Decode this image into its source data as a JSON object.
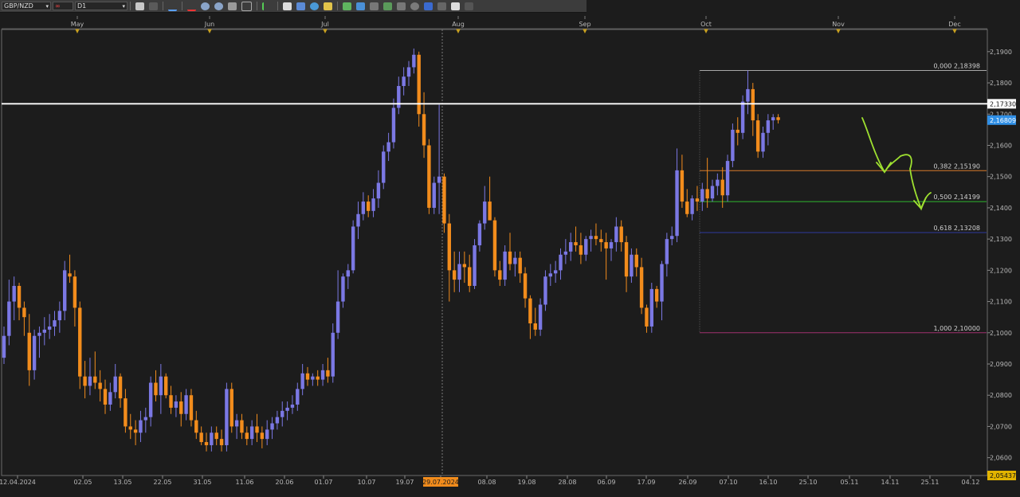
{
  "toolbar": {
    "symbol": "GBP/NZD",
    "period": "D1",
    "icons": [
      "candle-type-icon",
      "cursor-icon",
      "line-tool-icon",
      "zoom-in-icon",
      "zoom-out-icon",
      "crosshair-icon",
      "text-tool-icon",
      "circle-tool-icon",
      "pencil-icon",
      "indicator-icon",
      "settings-icon",
      "grid-icon",
      "clock-icon",
      "eraser-icon"
    ]
  },
  "chart_data": {
    "type": "candlestick",
    "symbol": "GBP/NZD",
    "timeframe": "D1",
    "ylim": [
      2.0543,
      2.1971
    ],
    "y_ticks": [
      "2,0600",
      "2,0700",
      "2,0800",
      "2,0900",
      "2,1000",
      "2,1100",
      "2,1200",
      "2,1300",
      "2,1400",
      "2,1500",
      "2,1600",
      "2,1700",
      "2,1800",
      "2,1900"
    ],
    "month_labels": [
      "May",
      "Jun",
      "Jul",
      "Aug",
      "Sep",
      "Oct",
      "Nov",
      "Dec"
    ],
    "date_labels": [
      "12.04.2024",
      "02.05",
      "13.05",
      "22.05",
      "31.05",
      "11.06",
      "20.06",
      "01.07",
      "10.07",
      "19.07",
      "29.07.2024",
      "08.08",
      "19.08",
      "28.08",
      "06.09",
      "17.09",
      "26.09",
      "07.10",
      "16.10",
      "25.10",
      "05.11",
      "14.11",
      "25.11",
      "04.12"
    ],
    "crosshair_date": "29.07.2024",
    "current_price": "2,16809",
    "horizontal_line": "2,17330",
    "axis_low_label": "2,05437",
    "fibonacci": [
      {
        "level": "0,000",
        "price": "2,18398",
        "color": "#a8a8a8"
      },
      {
        "level": "0,382",
        "price": "2,15190",
        "color": "#d77a2a"
      },
      {
        "level": "0,500",
        "price": "2,14199",
        "color": "#2fb82f"
      },
      {
        "level": "0,618",
        "price": "2,13208",
        "color": "#2e3a9e"
      },
      {
        "level": "1,000",
        "price": "2,10000",
        "color": "#a0306e"
      }
    ],
    "bull_color": "#7b78e4",
    "bear_color": "#f28c1c",
    "candles": [
      [
        2.092,
        2.102,
        2.09,
        2.099
      ],
      [
        2.099,
        2.117,
        2.096,
        2.11
      ],
      [
        2.11,
        2.118,
        2.104,
        2.115
      ],
      [
        2.115,
        2.116,
        2.104,
        2.108
      ],
      [
        2.108,
        2.11,
        2.099,
        2.105
      ],
      [
        2.1,
        2.106,
        2.083,
        2.088
      ],
      [
        2.088,
        2.101,
        2.085,
        2.099
      ],
      [
        2.099,
        2.102,
        2.092,
        2.1
      ],
      [
        2.1,
        2.105,
        2.096,
        2.101
      ],
      [
        2.101,
        2.106,
        2.098,
        2.102
      ],
      [
        2.102,
        2.107,
        2.099,
        2.104
      ],
      [
        2.104,
        2.11,
        2.1,
        2.107
      ],
      [
        2.107,
        2.123,
        2.104,
        2.12
      ],
      [
        2.119,
        2.125,
        2.116,
        2.118
      ],
      [
        2.118,
        2.12,
        2.102,
        2.108
      ],
      [
        2.108,
        2.11,
        2.082,
        2.086
      ],
      [
        2.086,
        2.091,
        2.079,
        2.083
      ],
      [
        2.083,
        2.092,
        2.08,
        2.086
      ],
      [
        2.086,
        2.094,
        2.082,
        2.084
      ],
      [
        2.084,
        2.088,
        2.078,
        2.082
      ],
      [
        2.082,
        2.085,
        2.074,
        2.077
      ],
      [
        2.077,
        2.084,
        2.075,
        2.081
      ],
      [
        2.081,
        2.09,
        2.079,
        2.086
      ],
      [
        2.086,
        2.087,
        2.076,
        2.079
      ],
      [
        2.079,
        2.082,
        2.068,
        2.07
      ],
      [
        2.07,
        2.074,
        2.066,
        2.069
      ],
      [
        2.069,
        2.072,
        2.064,
        2.068
      ],
      [
        2.068,
        2.075,
        2.065,
        2.072
      ],
      [
        2.072,
        2.076,
        2.068,
        2.073
      ],
      [
        2.073,
        2.086,
        2.07,
        2.084
      ],
      [
        2.084,
        2.088,
        2.078,
        2.08
      ],
      [
        2.08,
        2.09,
        2.074,
        2.086
      ],
      [
        2.086,
        2.087,
        2.079,
        2.08
      ],
      [
        2.08,
        2.083,
        2.074,
        2.076
      ],
      [
        2.076,
        2.08,
        2.073,
        2.078
      ],
      [
        2.078,
        2.081,
        2.07,
        2.074
      ],
      [
        2.074,
        2.082,
        2.072,
        2.08
      ],
      [
        2.08,
        2.082,
        2.07,
        2.072
      ],
      [
        2.072,
        2.075,
        2.066,
        2.068
      ],
      [
        2.068,
        2.07,
        2.064,
        2.065
      ],
      [
        2.065,
        2.068,
        2.062,
        2.064
      ],
      [
        2.064,
        2.07,
        2.062,
        2.068
      ],
      [
        2.068,
        2.07,
        2.064,
        2.066
      ],
      [
        2.066,
        2.069,
        2.062,
        2.064
      ],
      [
        2.064,
        2.084,
        2.062,
        2.082
      ],
      [
        2.082,
        2.084,
        2.068,
        2.07
      ],
      [
        2.07,
        2.074,
        2.066,
        2.072
      ],
      [
        2.072,
        2.074,
        2.066,
        2.068
      ],
      [
        2.068,
        2.07,
        2.064,
        2.066
      ],
      [
        2.066,
        2.072,
        2.064,
        2.07
      ],
      [
        2.07,
        2.074,
        2.065,
        2.068
      ],
      [
        2.068,
        2.07,
        2.063,
        2.066
      ],
      [
        2.066,
        2.072,
        2.064,
        2.069
      ],
      [
        2.069,
        2.073,
        2.066,
        2.071
      ],
      [
        2.071,
        2.075,
        2.069,
        2.073
      ],
      [
        2.073,
        2.078,
        2.07,
        2.075
      ],
      [
        2.075,
        2.078,
        2.072,
        2.076
      ],
      [
        2.076,
        2.08,
        2.074,
        2.077
      ],
      [
        2.077,
        2.084,
        2.075,
        2.082
      ],
      [
        2.082,
        2.09,
        2.08,
        2.087
      ],
      [
        2.087,
        2.089,
        2.083,
        2.085
      ],
      [
        2.085,
        2.087,
        2.083,
        2.086
      ],
      [
        2.086,
        2.088,
        2.083,
        2.085
      ],
      [
        2.085,
        2.09,
        2.083,
        2.088
      ],
      [
        2.088,
        2.092,
        2.084,
        2.086
      ],
      [
        2.086,
        2.103,
        2.084,
        2.1
      ],
      [
        2.1,
        2.12,
        2.098,
        2.11
      ],
      [
        2.11,
        2.119,
        2.108,
        2.118
      ],
      [
        2.118,
        2.122,
        2.114,
        2.12
      ],
      [
        2.12,
        2.136,
        2.119,
        2.134
      ],
      [
        2.134,
        2.142,
        2.13,
        2.138
      ],
      [
        2.138,
        2.145,
        2.136,
        2.142
      ],
      [
        2.142,
        2.144,
        2.137,
        2.139
      ],
      [
        2.139,
        2.146,
        2.137,
        2.143
      ],
      [
        2.143,
        2.152,
        2.14,
        2.148
      ],
      [
        2.148,
        2.16,
        2.146,
        2.158
      ],
      [
        2.158,
        2.164,
        2.155,
        2.161
      ],
      [
        2.161,
        2.175,
        2.159,
        2.172
      ],
      [
        2.172,
        2.182,
        2.17,
        2.179
      ],
      [
        2.179,
        2.185,
        2.176,
        2.182
      ],
      [
        2.182,
        2.187,
        2.179,
        2.185
      ],
      [
        2.185,
        2.191,
        2.183,
        2.189
      ],
      [
        2.189,
        2.19,
        2.166,
        2.17
      ],
      [
        2.17,
        2.177,
        2.156,
        2.16
      ],
      [
        2.16,
        2.162,
        2.138,
        2.14
      ],
      [
        2.14,
        2.15,
        2.138,
        2.148
      ],
      [
        2.148,
        2.173,
        2.138,
        2.15
      ],
      [
        2.15,
        2.151,
        2.132,
        2.135
      ],
      [
        2.135,
        2.138,
        2.11,
        2.12
      ],
      [
        2.12,
        2.126,
        2.113,
        2.117
      ],
      [
        2.117,
        2.126,
        2.113,
        2.122
      ],
      [
        2.122,
        2.126,
        2.116,
        2.121
      ],
      [
        2.121,
        2.125,
        2.113,
        2.115
      ],
      [
        2.115,
        2.13,
        2.114,
        2.128
      ],
      [
        2.128,
        2.136,
        2.126,
        2.135
      ],
      [
        2.135,
        2.147,
        2.133,
        2.142
      ],
      [
        2.142,
        2.15,
        2.139,
        2.136
      ],
      [
        2.136,
        2.137,
        2.118,
        2.12
      ],
      [
        2.12,
        2.123,
        2.115,
        2.117
      ],
      [
        2.117,
        2.128,
        2.115,
        2.126
      ],
      [
        2.126,
        2.132,
        2.12,
        2.122
      ],
      [
        2.122,
        2.126,
        2.118,
        2.124
      ],
      [
        2.124,
        2.126,
        2.116,
        2.119
      ],
      [
        2.119,
        2.121,
        2.108,
        2.111
      ],
      [
        2.111,
        2.112,
        2.098,
        2.103
      ],
      [
        2.103,
        2.108,
        2.099,
        2.101
      ],
      [
        2.101,
        2.111,
        2.099,
        2.109
      ],
      [
        2.109,
        2.12,
        2.107,
        2.118
      ],
      [
        2.118,
        2.122,
        2.115,
        2.119
      ],
      [
        2.119,
        2.123,
        2.116,
        2.12
      ],
      [
        2.12,
        2.127,
        2.117,
        2.125
      ],
      [
        2.125,
        2.13,
        2.122,
        2.126
      ],
      [
        2.126,
        2.132,
        2.123,
        2.129
      ],
      [
        2.129,
        2.134,
        2.126,
        2.128
      ],
      [
        2.128,
        2.132,
        2.122,
        2.125
      ],
      [
        2.125,
        2.131,
        2.123,
        2.13
      ],
      [
        2.13,
        2.133,
        2.126,
        2.131
      ],
      [
        2.131,
        2.135,
        2.128,
        2.13
      ],
      [
        2.13,
        2.133,
        2.126,
        2.129
      ],
      [
        2.129,
        2.132,
        2.117,
        2.127
      ],
      [
        2.127,
        2.13,
        2.123,
        2.129
      ],
      [
        2.129,
        2.137,
        2.126,
        2.134
      ],
      [
        2.134,
        2.136,
        2.126,
        2.129
      ],
      [
        2.129,
        2.131,
        2.113,
        2.118
      ],
      [
        2.118,
        2.127,
        2.116,
        2.125
      ],
      [
        2.125,
        2.127,
        2.118,
        2.121
      ],
      [
        2.121,
        2.124,
        2.106,
        2.108
      ],
      [
        2.108,
        2.109,
        2.1,
        2.102
      ],
      [
        2.102,
        2.116,
        2.1,
        2.114
      ],
      [
        2.114,
        2.115,
        2.108,
        2.11
      ],
      [
        2.11,
        2.123,
        2.104,
        2.122
      ],
      [
        2.122,
        2.132,
        2.118,
        2.13
      ],
      [
        2.13,
        2.134,
        2.128,
        2.131
      ],
      [
        2.131,
        2.159,
        2.129,
        2.152
      ],
      [
        2.152,
        2.157,
        2.14,
        2.142
      ],
      [
        2.142,
        2.146,
        2.137,
        2.138
      ],
      [
        2.138,
        2.144,
        2.136,
        2.143
      ],
      [
        2.143,
        2.147,
        2.139,
        2.142
      ],
      [
        2.142,
        2.148,
        2.139,
        2.146
      ],
      [
        2.146,
        2.156,
        2.14,
        2.143
      ],
      [
        2.143,
        2.149,
        2.142,
        2.147
      ],
      [
        2.147,
        2.151,
        2.144,
        2.149
      ],
      [
        2.149,
        2.153,
        2.14,
        2.144
      ],
      [
        2.144,
        2.157,
        2.142,
        2.155
      ],
      [
        2.155,
        2.167,
        2.153,
        2.165
      ],
      [
        2.165,
        2.169,
        2.16,
        2.164
      ],
      [
        2.164,
        2.176,
        2.162,
        2.174
      ],
      [
        2.174,
        2.184,
        2.17,
        2.178
      ],
      [
        2.178,
        2.18,
        2.163,
        2.168
      ],
      [
        2.168,
        2.17,
        2.156,
        2.158
      ],
      [
        2.158,
        2.166,
        2.156,
        2.164
      ],
      [
        2.164,
        2.17,
        2.16,
        2.168
      ],
      [
        2.168,
        2.17,
        2.165,
        2.169
      ],
      [
        2.169,
        2.17,
        2.167,
        2.1681
      ]
    ]
  }
}
